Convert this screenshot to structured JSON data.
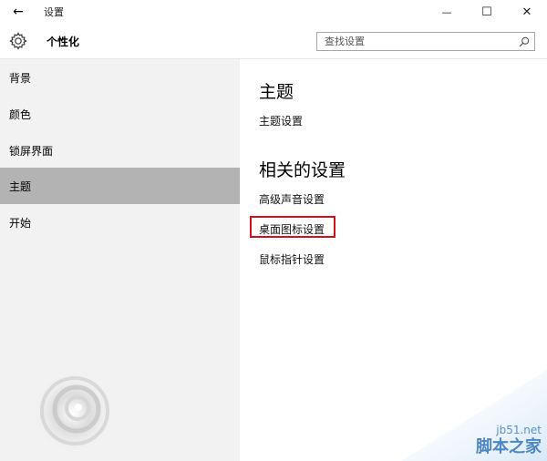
{
  "window": {
    "title": "设置",
    "back_glyph": "←",
    "minimize_glyph": "—",
    "maximize_glyph": "☐",
    "close_glyph": "✕"
  },
  "header": {
    "title": "个性化",
    "icon": "gear-icon",
    "search_placeholder": "查找设置"
  },
  "sidebar": {
    "items": [
      {
        "label": "背景",
        "selected": false
      },
      {
        "label": "颜色",
        "selected": false
      },
      {
        "label": "锁屏界面",
        "selected": false
      },
      {
        "label": "主题",
        "selected": true
      },
      {
        "label": "开始",
        "selected": false
      }
    ]
  },
  "main": {
    "section1_title": "主题",
    "section1_links": [
      "主题设置"
    ],
    "section2_title": "相关的设置",
    "section2_links": [
      "高级声音设置",
      "桌面图标设置",
      "鼠标指针设置"
    ],
    "highlighted_link": "桌面图标设置"
  },
  "watermark": {
    "line1": "jb51.net",
    "line2": "脚本之家"
  },
  "colors": {
    "selected_bg": "#b3b3b3",
    "sidebar_bg": "#f2f2f2",
    "highlight_border": "#d0101b",
    "watermark_blue": "#4e86c2"
  }
}
